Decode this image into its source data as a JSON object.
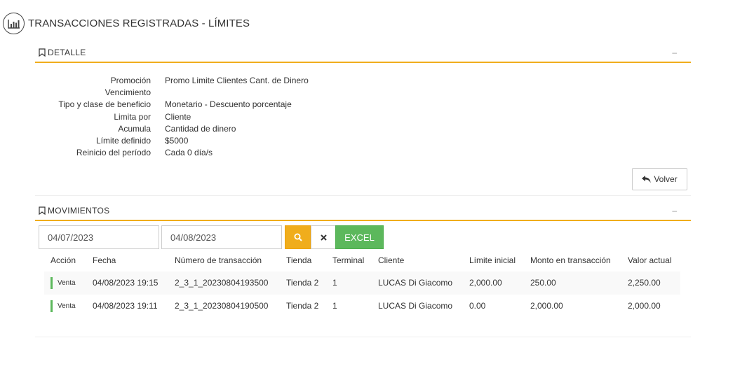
{
  "page": {
    "title": "TRANSACCIONES REGISTRADAS - LÍMITES",
    "icon": "bar-chart-icon"
  },
  "detail": {
    "section_title": "DETALLE",
    "collapse_label": "–",
    "fields": [
      {
        "label": "Promoción",
        "value": "Promo Limite Clientes Cant. de Dinero"
      },
      {
        "label": "Vencimiento",
        "value": ""
      },
      {
        "label": "Tipo y clase de beneficio",
        "value": "Monetario - Descuento porcentaje"
      },
      {
        "label": "Limita por",
        "value": "Cliente"
      },
      {
        "label": "Acumula",
        "value": "Cantidad de dinero"
      },
      {
        "label": "Límite definido",
        "value": "$5000"
      },
      {
        "label": "Reinicio del período",
        "value": "Cada 0 día/s"
      }
    ],
    "back_button": "Volver"
  },
  "movements": {
    "section_title": "MOVIMIENTOS",
    "collapse_label": "–",
    "date_from": "04/07/2023",
    "date_to": "04/08/2023",
    "excel_label": "EXCEL",
    "columns": [
      "Acción",
      "Fecha",
      "Número de transacción",
      "Tienda",
      "Terminal",
      "Cliente",
      "Límite inicial",
      "Monto en transacción",
      "Valor actual"
    ],
    "rows": [
      {
        "accion": "Venta",
        "fecha": "04/08/2023 19:15",
        "numero": "2_3_1_20230804193500",
        "tienda": "Tienda 2",
        "terminal": "1",
        "cliente": "LUCAS Di Giacomo",
        "limite_inicial": "2,000.00",
        "monto": "250.00",
        "valor_actual": "2,250.00"
      },
      {
        "accion": "Venta",
        "fecha": "04/08/2023 19:11",
        "numero": "2_3_1_20230804190500",
        "tienda": "Tienda 2",
        "terminal": "1",
        "cliente": "LUCAS Di Giacomo",
        "limite_inicial": "0.00",
        "monto": "2,000.00",
        "valor_actual": "2,000.00"
      }
    ]
  },
  "colors": {
    "accent": "#f0ad1c",
    "excel": "#5cb85c",
    "action_bar": "#5cb85c"
  }
}
